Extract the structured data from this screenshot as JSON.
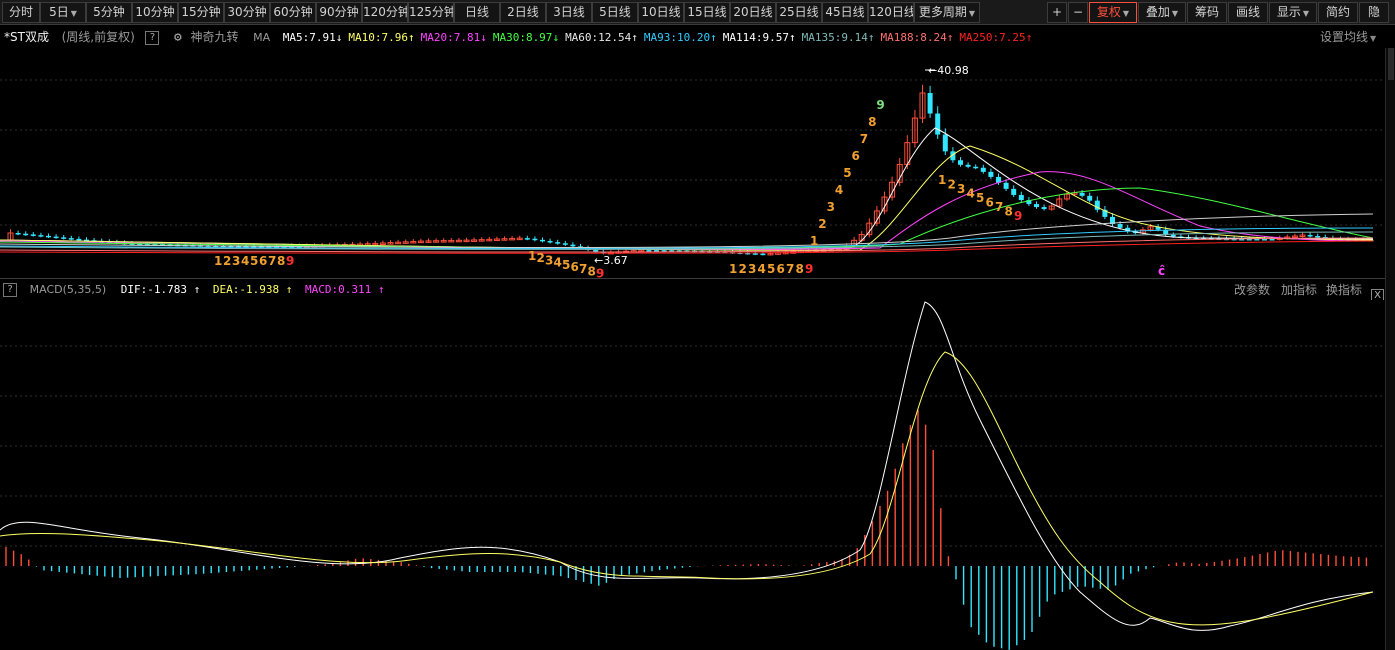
{
  "toolbar": {
    "periods": [
      "分时",
      "5日",
      "5分钟",
      "10分钟",
      "15分钟",
      "30分钟",
      "60分钟",
      "90分钟",
      "120分钟",
      "125分钟",
      "日线",
      "2日线",
      "3日线",
      "5日线",
      "10日线",
      "15日线",
      "20日线",
      "25日线",
      "45日线",
      "120日线",
      "更多周期"
    ],
    "tools": [
      "+",
      "−",
      "复权",
      "叠加",
      "筹码",
      "画线",
      "显示",
      "简约",
      "隐"
    ],
    "active_tool": "复权",
    "active_color": "#ff4e3a"
  },
  "ma_bar": {
    "stock_name": "*ST双成",
    "mode": "(周线,前复权)",
    "help": "?",
    "indicator": "神奇九转",
    "ma_label": "MA",
    "settings_label": "设置均线",
    "items": [
      {
        "text": "MA5:7.91",
        "arrow": "↓",
        "color": "#ffffff"
      },
      {
        "text": "MA10:7.96",
        "arrow": "↑",
        "color": "#ffff66"
      },
      {
        "text": "MA20:7.81",
        "arrow": "↓",
        "color": "#ff44ff"
      },
      {
        "text": "MA30:8.97",
        "arrow": "↓",
        "color": "#44ff44"
      },
      {
        "text": "MA60:12.54",
        "arrow": "↑",
        "color": "#e8e8e8"
      },
      {
        "text": "MA93:10.20",
        "arrow": "↑",
        "color": "#33ccff"
      },
      {
        "text": "MA114:9.57",
        "arrow": "↑",
        "color": "#ffffff"
      },
      {
        "text": "MA135:9.14",
        "arrow": "↑",
        "color": "#7fb8b8"
      },
      {
        "text": "MA188:8.24",
        "arrow": "↑",
        "color": "#ff7070"
      },
      {
        "text": "MA250:7.25",
        "arrow": "↑",
        "color": "#ff2020"
      }
    ]
  },
  "macd_bar": {
    "help": "?",
    "name": "MACD(5,35,5)",
    "dif": {
      "text": "DIF:-1.783",
      "arrow": "↑",
      "color": "#ffffff"
    },
    "dea": {
      "text": "DEA:-1.938",
      "arrow": "↑",
      "color": "#ffff66"
    },
    "macd": {
      "text": "MACD:0.311",
      "arrow": "↑",
      "color": "#ff44ff"
    },
    "actions": [
      "改参数",
      "加指标",
      "换指标"
    ],
    "close": "X"
  },
  "annotations": {
    "high": "40.98",
    "low": "3.67",
    "td_seq_1": [
      "1",
      "2",
      "3",
      "4",
      "5",
      "6",
      "7",
      "8",
      "9"
    ],
    "td_seq_2": [
      "1",
      "2",
      "3",
      "4",
      "5",
      "6",
      "7",
      "8",
      "9"
    ],
    "td_seq_3": [
      "1",
      "2",
      "3",
      "4",
      "5",
      "6",
      "7",
      "8",
      "9"
    ],
    "td_up": [
      "1",
      "2",
      "3",
      "4",
      "5",
      "6",
      "7",
      "8",
      "9"
    ],
    "td_down": [
      "1",
      "2",
      "3",
      "4",
      "5",
      "6",
      "7",
      "8",
      "9"
    ],
    "marker": "ĉ"
  },
  "colors": {
    "up": "#ff4e3a",
    "down": "#33e6ff",
    "td_number": "#f0a030",
    "td_nine": "#ff3030",
    "grid": "#2e2e2e",
    "marker": "#ff44ff"
  }
}
